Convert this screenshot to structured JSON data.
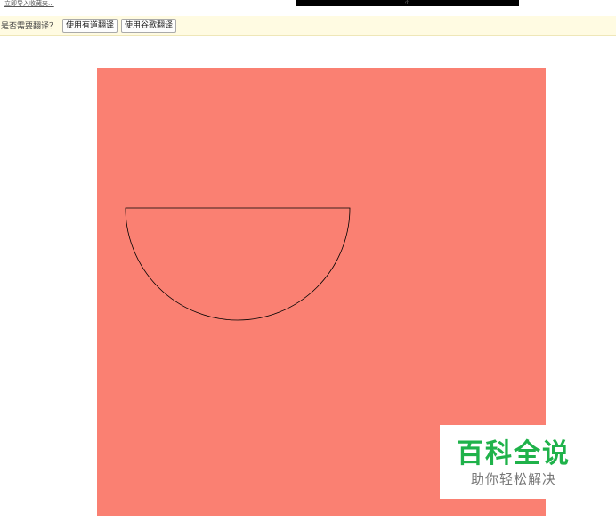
{
  "header": {
    "import_link": "立即导入收藏夹...",
    "banner_text": "小"
  },
  "translate_bar": {
    "prompt": "是否需要翻译？",
    "youdao_button": "使用有道翻译",
    "google_button": "使用谷歌翻译"
  },
  "canvas": {
    "background_color": "#fa8072",
    "shape": "half-circle",
    "stroke_color": "#000000"
  },
  "watermark": {
    "title": "百科全说",
    "subtitle": "助你轻松解决",
    "title_color": "#1fb24a"
  }
}
